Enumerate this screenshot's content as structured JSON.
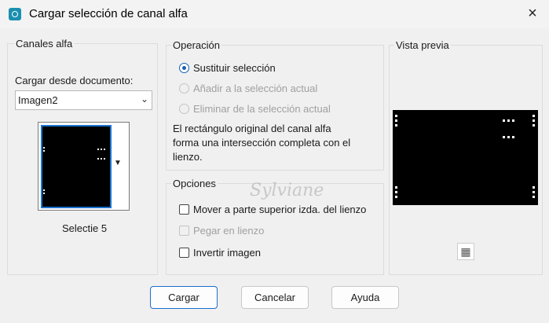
{
  "window": {
    "title": "Cargar selección de canal alfa",
    "close_icon": "×"
  },
  "alpha_channels": {
    "group_label": "Canales alfa",
    "load_from_label": "Cargar desde documento:",
    "document_value": "Imagen2",
    "selection_name": "Selectie 5"
  },
  "operation": {
    "group_label": "Operación",
    "options": [
      {
        "label": "Sustituir selección",
        "selected": true,
        "enabled": true
      },
      {
        "label": "Añadir a la selección actual",
        "selected": false,
        "enabled": false
      },
      {
        "label": "Eliminar de la selección actual",
        "selected": false,
        "enabled": false
      }
    ],
    "description": "El rectángulo original del canal alfa\nforma una intersección completa con el\nlienzo."
  },
  "options": {
    "group_label": "Opciones",
    "items": [
      {
        "label": "Mover a parte superior izda. del lienzo",
        "checked": false,
        "enabled": true
      },
      {
        "label": "Pegar en lienzo",
        "checked": false,
        "enabled": false
      },
      {
        "label": "Invertir imagen",
        "checked": false,
        "enabled": true
      }
    ]
  },
  "preview": {
    "group_label": "Vista previa",
    "zoom_icon": "checker-zoom-icon"
  },
  "buttons": {
    "load": "Cargar",
    "cancel": "Cancelar",
    "help": "Ayuda"
  },
  "watermark": {
    "text": "Sylviane"
  }
}
